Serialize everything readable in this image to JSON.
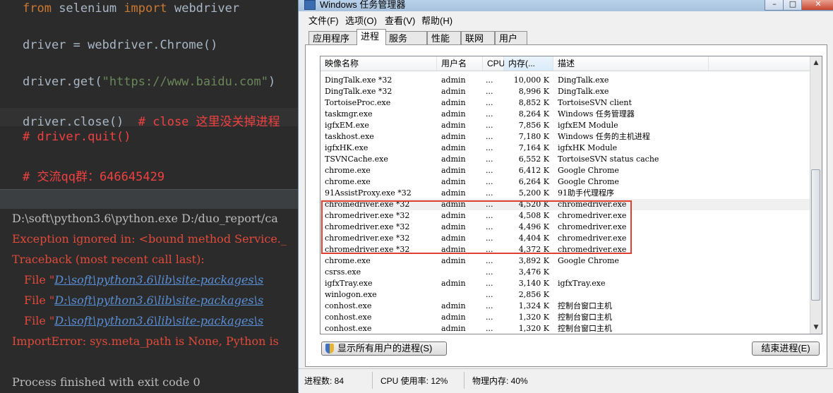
{
  "editor": {
    "lines": [
      {
        "kw1": "from",
        "mid": " selenium ",
        "kw2": "import",
        "rest": " webdriver"
      },
      {
        "text": "driver = webdriver.Chrome()"
      },
      {
        "pre": "driver.get(",
        "str": "\"https://www.baidu.com\"",
        "post": ")"
      },
      {
        "code": "driver.close()",
        "comment": "  # close 这里没关掉进程"
      },
      {
        "comment": "# driver.quit()"
      },
      {
        "comment": "# 交流qq群：646645429"
      }
    ]
  },
  "console": {
    "cmd": "D:\\soft\\python3.6\\python.exe D:/duo_report/ca",
    "exception": "Exception ignored in: <bound method Service._",
    "traceback": "Traceback (most recent call last):",
    "file_prefix": "File \"",
    "file_link": "D:\\soft\\python3.6\\lib\\site-packages\\s",
    "import_error": "ImportError: sys.meta_path is None, Python is",
    "finished": "Process finished with exit code 0"
  },
  "taskmgr": {
    "title": "Windows 任务管理器",
    "controls": [
      "–",
      "□",
      "✕"
    ],
    "menu": [
      "文件(F)",
      "选项(O)",
      "查看(V)",
      "帮助(H)"
    ],
    "tabs": [
      "应用程序",
      "进程",
      "服务",
      "性能",
      "联网",
      "用户"
    ],
    "active_tab": 1,
    "columns": [
      "映像名称",
      "用户名",
      "CPU",
      "内存(...",
      "描述"
    ],
    "rows": [
      {
        "name": "DingTalk.exe *32",
        "user": "admin",
        "cpu": "...",
        "mem": "10,000 K",
        "desc": "DingTalk.exe"
      },
      {
        "name": "DingTalk.exe *32",
        "user": "admin",
        "cpu": "...",
        "mem": "8,996 K",
        "desc": "DingTalk.exe"
      },
      {
        "name": "TortoiseProc.exe",
        "user": "admin",
        "cpu": "...",
        "mem": "8,852 K",
        "desc": "TortoiseSVN client"
      },
      {
        "name": "taskmgr.exe",
        "user": "admin",
        "cpu": "...",
        "mem": "8,264 K",
        "desc": "Windows 任务管理器"
      },
      {
        "name": "igfxEM.exe",
        "user": "admin",
        "cpu": "...",
        "mem": "7,856 K",
        "desc": "igfxEM Module"
      },
      {
        "name": "taskhost.exe",
        "user": "admin",
        "cpu": "...",
        "mem": "7,180 K",
        "desc": "Windows 任务的主机进程"
      },
      {
        "name": "igfxHK.exe",
        "user": "admin",
        "cpu": "...",
        "mem": "7,164 K",
        "desc": "igfxHK Module"
      },
      {
        "name": "TSVNCache.exe",
        "user": "admin",
        "cpu": "...",
        "mem": "6,552 K",
        "desc": "TortoiseSVN status cache"
      },
      {
        "name": "chrome.exe",
        "user": "admin",
        "cpu": "...",
        "mem": "6,412 K",
        "desc": "Google Chrome"
      },
      {
        "name": "chrome.exe",
        "user": "admin",
        "cpu": "...",
        "mem": "6,264 K",
        "desc": "Google Chrome"
      },
      {
        "name": "91AssistProxy.exe *32",
        "user": "admin",
        "cpu": "...",
        "mem": "5,200 K",
        "desc": "91助手代理程序"
      },
      {
        "name": "chromedriver.exe *32",
        "user": "admin",
        "cpu": "...",
        "mem": "4,520 K",
        "desc": "chromedriver.exe"
      },
      {
        "name": "chromedriver.exe *32",
        "user": "admin",
        "cpu": "...",
        "mem": "4,508 K",
        "desc": "chromedriver.exe"
      },
      {
        "name": "chromedriver.exe *32",
        "user": "admin",
        "cpu": "...",
        "mem": "4,496 K",
        "desc": "chromedriver.exe"
      },
      {
        "name": "chromedriver.exe *32",
        "user": "admin",
        "cpu": "...",
        "mem": "4,404 K",
        "desc": "chromedriver.exe"
      },
      {
        "name": "chromedriver.exe *32",
        "user": "admin",
        "cpu": "...",
        "mem": "4,372 K",
        "desc": "chromedriver.exe"
      },
      {
        "name": "chrome.exe",
        "user": "admin",
        "cpu": "...",
        "mem": "3,892 K",
        "desc": "Google Chrome"
      },
      {
        "name": "csrss.exe",
        "user": "",
        "cpu": "...",
        "mem": "3,476 K",
        "desc": ""
      },
      {
        "name": "igfxTray.exe",
        "user": "admin",
        "cpu": "...",
        "mem": "3,140 K",
        "desc": "igfxTray.exe"
      },
      {
        "name": "winlogon.exe",
        "user": "",
        "cpu": "...",
        "mem": "2,856 K",
        "desc": ""
      },
      {
        "name": "conhost.exe",
        "user": "admin",
        "cpu": "...",
        "mem": "1,324 K",
        "desc": "控制台窗口主机"
      },
      {
        "name": "conhost.exe",
        "user": "admin",
        "cpu": "...",
        "mem": "1,320 K",
        "desc": "控制台窗口主机"
      },
      {
        "name": "conhost.exe",
        "user": "admin",
        "cpu": "...",
        "mem": "1,320 K",
        "desc": "控制台窗口主机"
      }
    ],
    "show_all_button": "显示所有用户的进程(S)",
    "end_process_button": "结束进程(E)",
    "status": {
      "processes": "进程数: 84",
      "cpu": "CPU 使用率: 12%",
      "memory": "物理内存: 40%"
    }
  }
}
